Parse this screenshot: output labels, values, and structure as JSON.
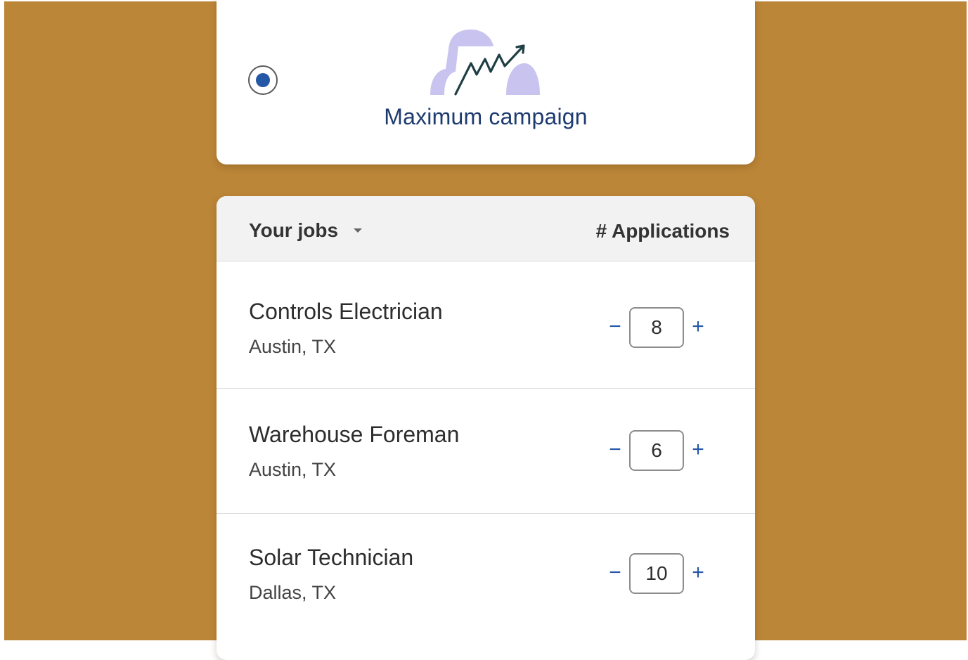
{
  "campaign": {
    "title": "Maximum campaign",
    "selected": true,
    "illustration": "trend-chart-icon",
    "accent_color": "#2557a7",
    "background_color": "#bc8638"
  },
  "table": {
    "jobs_label": "Your jobs",
    "applications_label": "# Applications",
    "rows": [
      {
        "title": "Controls Electrician",
        "location": "Austin, TX",
        "applications": "8"
      },
      {
        "title": "Warehouse Foreman",
        "location": "Austin, TX",
        "applications": "6"
      },
      {
        "title": "Solar Technician",
        "location": "Dallas, TX",
        "applications": "10"
      }
    ]
  },
  "icons": {
    "minus": "−",
    "plus": "+"
  }
}
